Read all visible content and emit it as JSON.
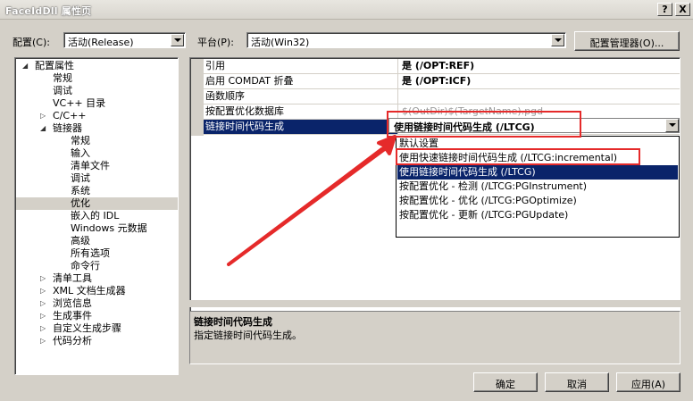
{
  "window": {
    "title": "FaceIdDll 属性页",
    "help_btn": "?",
    "close_btn": "X"
  },
  "toolbar": {
    "config_label": "配置(C):",
    "config_value": "活动(Release)",
    "platform_label": "平台(P):",
    "platform_value": "活动(Win32)",
    "config_manager": "配置管理器(O)..."
  },
  "tree": {
    "items": [
      {
        "label": "配置属性",
        "toggle": "◢"
      },
      {
        "label": "常规"
      },
      {
        "label": "调试"
      },
      {
        "label": "VC++ 目录"
      },
      {
        "label": "C/C++",
        "toggle": "▷"
      },
      {
        "label": "链接器",
        "toggle": "◢"
      },
      {
        "label": "常规"
      },
      {
        "label": "输入"
      },
      {
        "label": "清单文件"
      },
      {
        "label": "调试"
      },
      {
        "label": "系统"
      },
      {
        "label": "优化"
      },
      {
        "label": "嵌入的 IDL"
      },
      {
        "label": "Windows 元数据"
      },
      {
        "label": "高级"
      },
      {
        "label": "所有选项"
      },
      {
        "label": "命令行"
      },
      {
        "label": "清单工具",
        "toggle": "▷"
      },
      {
        "label": "XML 文档生成器",
        "toggle": "▷"
      },
      {
        "label": "浏览信息",
        "toggle": "▷"
      },
      {
        "label": "生成事件",
        "toggle": "▷"
      },
      {
        "label": "自定义生成步骤",
        "toggle": "▷"
      },
      {
        "label": "代码分析",
        "toggle": "▷"
      }
    ]
  },
  "grid": {
    "rows": [
      {
        "name": "引用",
        "value": "是 (/OPT:REF)"
      },
      {
        "name": "启用 COMDAT 折叠",
        "value": "是 (/OPT:ICF)"
      },
      {
        "name": "函数顺序",
        "value": ""
      },
      {
        "name": "按配置优化数据库",
        "value": "$(OutDir)$(TargetName).pgd"
      },
      {
        "name": "链接时间代码生成",
        "value": "使用链接时间代码生成 (/LTCG)"
      }
    ]
  },
  "dropdown": {
    "items": [
      "默认设置",
      "使用快速链接时间代码生成 (/LTCG:incremental)",
      "使用链接时间代码生成 (/LTCG)",
      "按配置优化 - 检测 (/LTCG:PGInstrument)",
      "按配置优化 - 优化 (/LTCG:PGOptimize)",
      "按配置优化 - 更新 (/LTCG:PGUpdate)"
    ]
  },
  "description": {
    "title": "链接时间代码生成",
    "text": "指定链接时间代码生成。"
  },
  "buttons": {
    "ok": "确定",
    "cancel": "取消",
    "apply": "应用(A)"
  },
  "colors": {
    "selection": "#0a246a",
    "annotation": "#e52a2a",
    "face": "#d4d0c8"
  }
}
